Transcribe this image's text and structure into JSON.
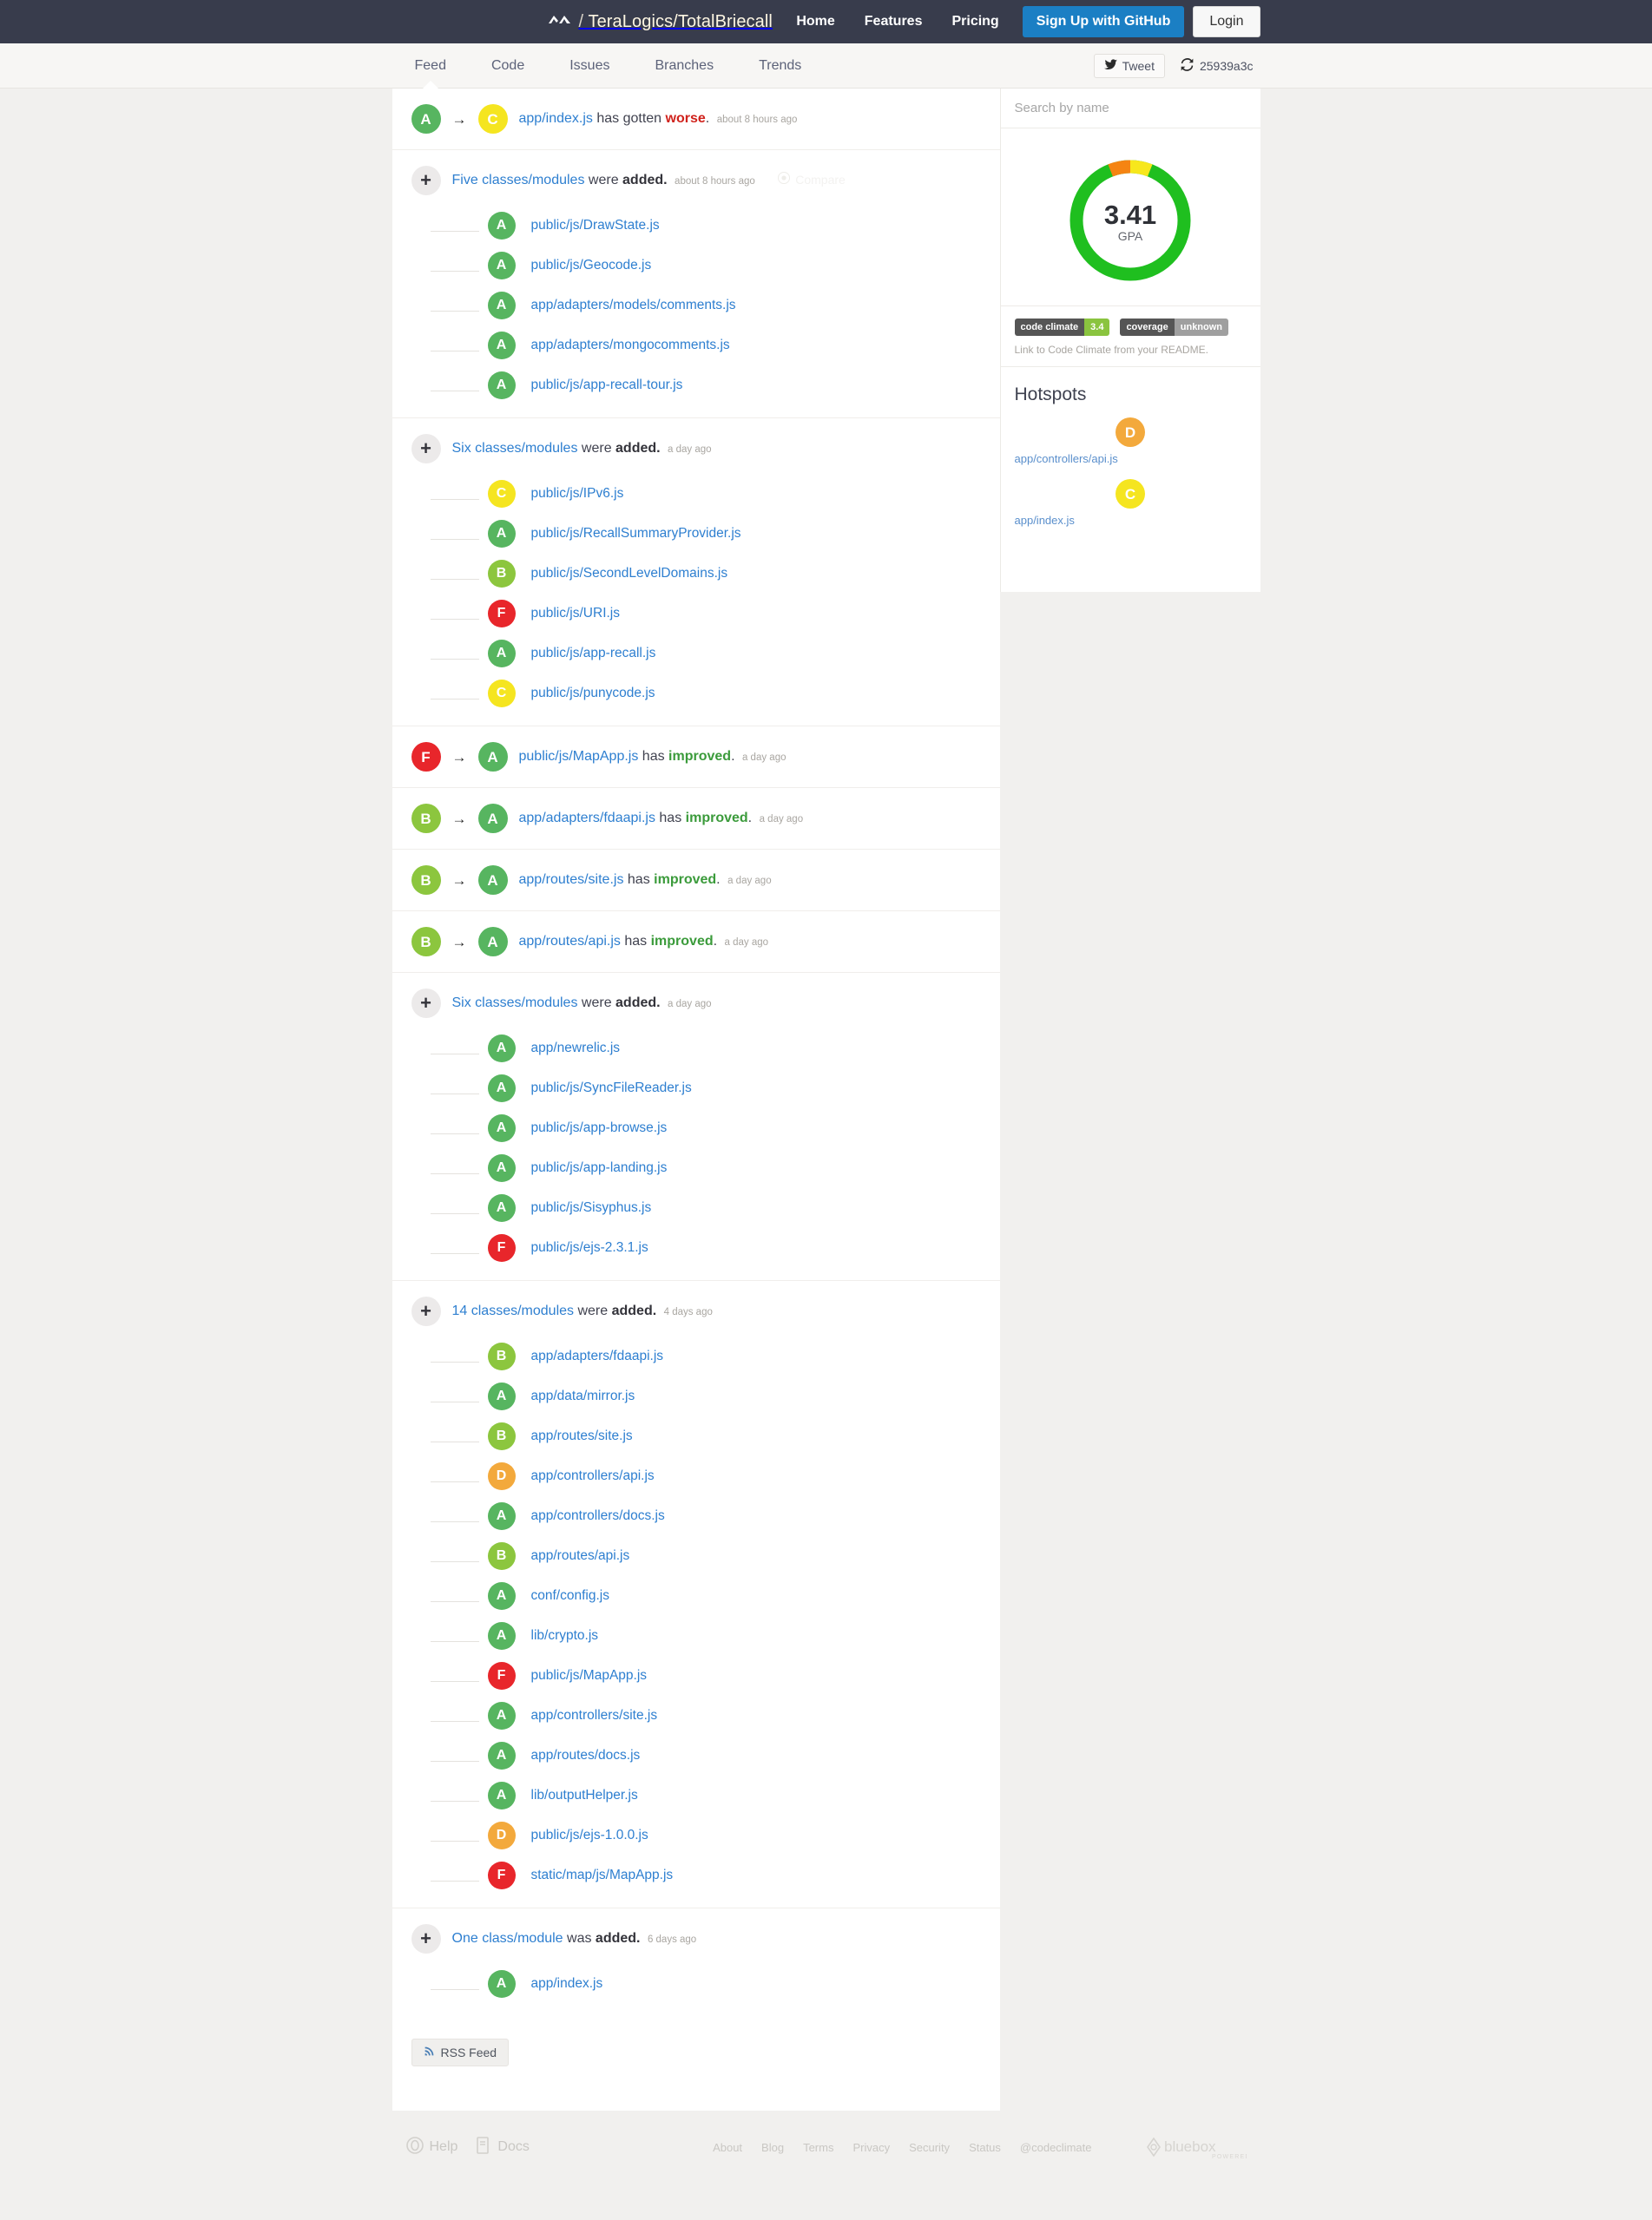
{
  "header": {
    "brand_repo": "TeraLogics/TotalBriecall",
    "brand_slash": "/",
    "logo_icon": "codeclimate-logo-icon",
    "nav": [
      {
        "label": "Home",
        "name": "nav-home"
      },
      {
        "label": "Features",
        "name": "nav-features"
      },
      {
        "label": "Pricing",
        "name": "nav-pricing"
      }
    ],
    "signup_label": "Sign Up with GitHub",
    "login_label": "Login"
  },
  "tabs": {
    "items": [
      {
        "label": "Feed",
        "active": true
      },
      {
        "label": "Code",
        "active": false
      },
      {
        "label": "Issues",
        "active": false
      },
      {
        "label": "Branches",
        "active": false
      },
      {
        "label": "Trends",
        "active": false
      }
    ],
    "tweet_label": "Tweet",
    "tweet_icon": "twitter-bird-icon",
    "commit_ref": "25939a3c",
    "commit_icon": "refresh-icon"
  },
  "feed": {
    "events": [
      {
        "type": "grade-change",
        "from_grade": "A",
        "to_grade": "C",
        "file": "app/index.js",
        "verb_prefix": "has gotten",
        "verb": "worse",
        "verb_kind": "worse",
        "timestamp": "about 8 hours ago"
      },
      {
        "type": "group",
        "count_label": "Five classes/modules",
        "tail": "were added.",
        "timestamp": "about 8 hours ago",
        "compare_label": "Compare",
        "compare_icon": "github-icon",
        "children": [
          {
            "grade": "A",
            "file": "public/js/DrawState.js"
          },
          {
            "grade": "A",
            "file": "public/js/Geocode.js"
          },
          {
            "grade": "A",
            "file": "app/adapters/models/comments.js"
          },
          {
            "grade": "A",
            "file": "app/adapters/mongocomments.js"
          },
          {
            "grade": "A",
            "file": "public/js/app-recall-tour.js"
          }
        ]
      },
      {
        "type": "group",
        "count_label": "Six classes/modules",
        "tail": "were added.",
        "timestamp": "a day ago",
        "children": [
          {
            "grade": "C",
            "file": "public/js/IPv6.js"
          },
          {
            "grade": "A",
            "file": "public/js/RecallSummaryProvider.js"
          },
          {
            "grade": "B",
            "file": "public/js/SecondLevelDomains.js"
          },
          {
            "grade": "F",
            "file": "public/js/URI.js"
          },
          {
            "grade": "A",
            "file": "public/js/app-recall.js"
          },
          {
            "grade": "C",
            "file": "public/js/punycode.js"
          }
        ]
      },
      {
        "type": "grade-change",
        "from_grade": "F",
        "to_grade": "A",
        "file": "public/js/MapApp.js",
        "verb_prefix": "has",
        "verb": "improved",
        "verb_kind": "improved",
        "timestamp": "a day ago"
      },
      {
        "type": "grade-change",
        "from_grade": "B",
        "to_grade": "A",
        "file": "app/adapters/fdaapi.js",
        "verb_prefix": "has",
        "verb": "improved",
        "verb_kind": "improved",
        "timestamp": "a day ago"
      },
      {
        "type": "grade-change",
        "from_grade": "B",
        "to_grade": "A",
        "file": "app/routes/site.js",
        "verb_prefix": "has",
        "verb": "improved",
        "verb_kind": "improved",
        "timestamp": "a day ago"
      },
      {
        "type": "grade-change",
        "from_grade": "B",
        "to_grade": "A",
        "file": "app/routes/api.js",
        "verb_prefix": "has",
        "verb": "improved",
        "verb_kind": "improved",
        "timestamp": "a day ago"
      },
      {
        "type": "group",
        "count_label": "Six classes/modules",
        "tail": "were added.",
        "timestamp": "a day ago",
        "children": [
          {
            "grade": "A",
            "file": "app/newrelic.js"
          },
          {
            "grade": "A",
            "file": "public/js/SyncFileReader.js"
          },
          {
            "grade": "A",
            "file": "public/js/app-browse.js"
          },
          {
            "grade": "A",
            "file": "public/js/app-landing.js"
          },
          {
            "grade": "A",
            "file": "public/js/Sisyphus.js"
          },
          {
            "grade": "F",
            "file": "public/js/ejs-2.3.1.js"
          }
        ]
      },
      {
        "type": "group",
        "count_label": "14 classes/modules",
        "tail": "were added.",
        "timestamp": "4 days ago",
        "children": [
          {
            "grade": "B",
            "file": "app/adapters/fdaapi.js"
          },
          {
            "grade": "A",
            "file": "app/data/mirror.js"
          },
          {
            "grade": "B",
            "file": "app/routes/site.js"
          },
          {
            "grade": "D",
            "file": "app/controllers/api.js"
          },
          {
            "grade": "A",
            "file": "app/controllers/docs.js"
          },
          {
            "grade": "B",
            "file": "app/routes/api.js"
          },
          {
            "grade": "A",
            "file": "conf/config.js"
          },
          {
            "grade": "A",
            "file": "lib/crypto.js"
          },
          {
            "grade": "F",
            "file": "public/js/MapApp.js"
          },
          {
            "grade": "A",
            "file": "app/controllers/site.js"
          },
          {
            "grade": "A",
            "file": "app/routes/docs.js"
          },
          {
            "grade": "A",
            "file": "lib/outputHelper.js"
          },
          {
            "grade": "D",
            "file": "public/js/ejs-1.0.0.js"
          },
          {
            "grade": "F",
            "file": "static/map/js/MapApp.js"
          }
        ]
      },
      {
        "type": "group",
        "count_label": "One class/module",
        "tail": "was added.",
        "timestamp": "6 days ago",
        "children": [
          {
            "grade": "A",
            "file": "app/index.js"
          }
        ]
      }
    ],
    "rss_label": "RSS Feed",
    "rss_icon": "rss-icon"
  },
  "sidebar": {
    "search_placeholder": "Search by name",
    "gpa_value": "3.41",
    "gpa_label": "GPA",
    "badges": [
      {
        "label": "code climate",
        "value": "3.4",
        "value_color": "green"
      },
      {
        "label": "coverage",
        "value": "unknown",
        "value_color": "gray"
      }
    ],
    "badge_note": "Link to Code Climate from your README.",
    "hotspots_title": "Hotspots",
    "hotspots": [
      {
        "grade": "D",
        "file": "app/controllers/api.js"
      },
      {
        "grade": "C",
        "file": "app/index.js"
      }
    ]
  },
  "footer": {
    "left": [
      {
        "label": "Help",
        "icon": "lifebuoy-icon"
      },
      {
        "label": "Docs",
        "icon": "book-icon"
      }
    ],
    "links": [
      "About",
      "Blog",
      "Terms",
      "Privacy",
      "Security",
      "Status",
      "@codeclimate"
    ],
    "powered_brand": "bluebox",
    "powered_label": "POWERED"
  },
  "chart_data": {
    "type": "pie",
    "title": "GPA",
    "center_value": "3.41",
    "center_label": "GPA",
    "categories": [
      "A (green)",
      "C (yellow)",
      "D (orange)"
    ],
    "values": [
      88,
      6,
      6
    ],
    "colors": [
      "#1fbf1f",
      "#f7e71c",
      "#f58412"
    ],
    "legend": "none",
    "donut": true
  },
  "colors": {
    "brand_dark": "#383c4c",
    "accent_blue": "#1b7fc4",
    "link_blue": "#2e7fd0",
    "grade_a": "#57b560",
    "grade_b": "#8cc63e",
    "grade_c": "#f5e520",
    "grade_d": "#f3a93c",
    "grade_f": "#e8262b",
    "worse_red": "#d0221c",
    "improved_green": "#3b9b3b"
  }
}
